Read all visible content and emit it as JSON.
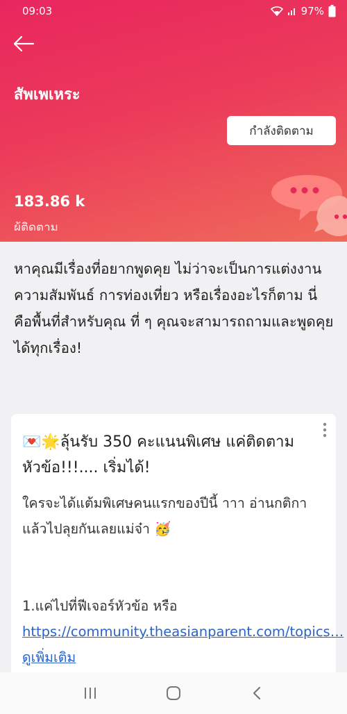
{
  "status_bar": {
    "time": "09:03",
    "battery": "97%"
  },
  "header": {
    "title": "สัพเพเหระ",
    "follow_button": "กำลังติดตาม",
    "followers_count": "183.86 k",
    "followers_label": "ผู้ติดตาม"
  },
  "description": "หาคุณมีเรื่องที่อยากพูดคุย ไม่ว่าจะเป็นการแต่งงาน ความสัมพันธ์ การท่องเที่ยว หรือเรื่องอะไรก็ตาม นี่คือพื้นที่สำหรับคุณ ที่ ๆ คุณจะสามารถถามและพูดคุยได้ทุกเรื่อง!",
  "post": {
    "title_emojis": "💌🌟",
    "title": "ลุ้นรับ 350 คะแนนพิเศษ แค่ติดตามหัวข้อ!!!.... เริ่มได้!",
    "body": "ใครจะได้แต้มพิเศษคนแรกของปีนี้ าาา อ่านกติกาแล้วไปลุยกันเลยแม่จ๋า",
    "body_emoji": "🥳",
    "step_text": "1.แค่ไปที่ฟีเจอร์หัวข้อ หรือ ",
    "link_text": "https://community.theasianparent.com/topics…",
    "see_more": "ดูเพิ่มเติม"
  },
  "colors": {
    "header_start": "#e8265e",
    "header_end": "#ef6a5a",
    "link": "#2b63c6"
  },
  "icons": {
    "back": "arrow-left-icon",
    "more": "more-vertical-icon",
    "bubble": "chat-bubble-icon",
    "nav_recents": "recents-icon",
    "nav_home": "home-icon",
    "nav_back": "back-icon"
  }
}
